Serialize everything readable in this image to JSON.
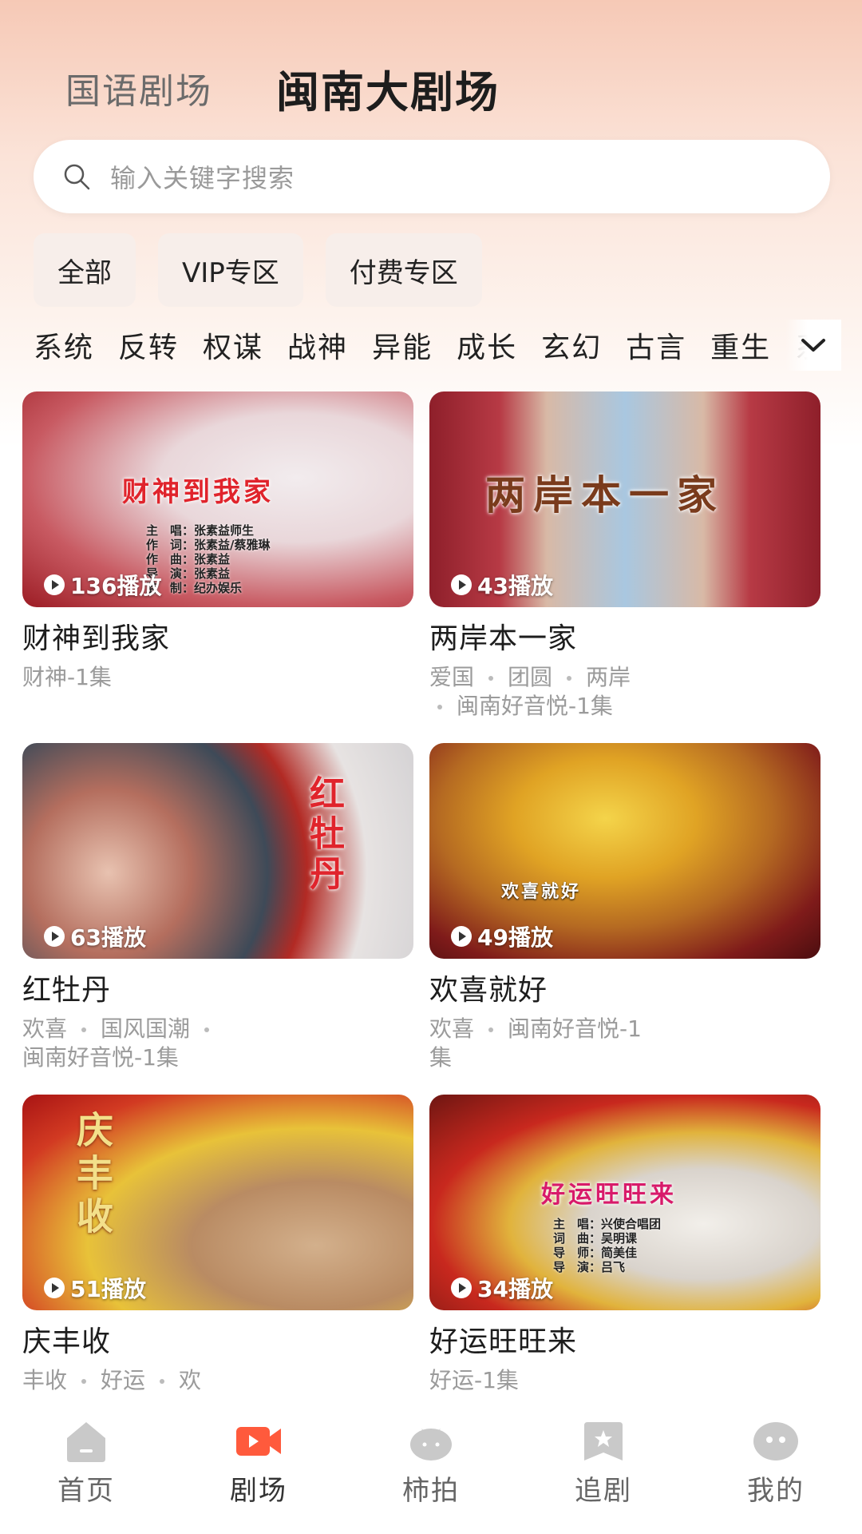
{
  "header": {
    "tabs": [
      {
        "label": "国语剧场",
        "active": false
      },
      {
        "label": "闽南大剧场",
        "active": true
      }
    ]
  },
  "search": {
    "placeholder": "输入关键字搜索",
    "icon": "search-icon"
  },
  "filters": [
    "全部",
    "VIP专区",
    "付费专区"
  ],
  "categories": [
    "系统",
    "反转",
    "权谋",
    "战神",
    "异能",
    "成长",
    "玄幻",
    "古言",
    "重生",
    "系"
  ],
  "cards": [
    {
      "thumb_text": "财神到我家",
      "credits": [
        "主　唱：张素益师生",
        "作　词：张素益/蔡雅琳",
        "作　曲：张素益",
        "导　演：张素益",
        "监　制：纪办娱乐"
      ],
      "plays": "136播放",
      "title": "财神到我家",
      "tags_line1": [
        "财神-1集"
      ],
      "tags_line2": []
    },
    {
      "thumb_text": "两岸本一家",
      "credits": [],
      "plays": "43播放",
      "title": "两岸本一家",
      "tags_line1": [
        "爱国",
        "团圆",
        "两岸"
      ],
      "tags_line2": [
        "闽南好音悦-1集"
      ]
    },
    {
      "thumb_text": "红牡丹",
      "credits": [],
      "plays": "63播放",
      "title": "红牡丹",
      "tags_line1": [
        "欢喜",
        "国风国潮"
      ],
      "tags_line2": [
        "闽南好音悦-1集"
      ]
    },
    {
      "thumb_text": "欢喜就好",
      "credits": [],
      "plays": "49播放",
      "title": "欢喜就好",
      "tags_line1": [
        "欢喜",
        "闽南好音悦-1"
      ],
      "tags_line2": [
        "集"
      ]
    },
    {
      "thumb_text": "庆丰收",
      "credits": [],
      "plays": "51播放",
      "title": "庆丰收",
      "tags_line1": [
        "丰收",
        "好运",
        "欢"
      ],
      "tags_line2": []
    },
    {
      "thumb_text": "好运旺旺来",
      "credits": [
        "主　唱：兴使合唱团",
        "词　曲：吴明课",
        "导　师：简美佳",
        "导　演：吕飞"
      ],
      "plays": "34播放",
      "title": "好运旺旺来",
      "tags_line1": [
        "好运-1集"
      ],
      "tags_line2": []
    }
  ],
  "tabbar": [
    {
      "label": "首页",
      "icon": "home-icon",
      "active": false
    },
    {
      "label": "剧场",
      "icon": "video-camera-icon",
      "active": true
    },
    {
      "label": "柿拍",
      "icon": "persimmon-icon",
      "active": false
    },
    {
      "label": "追剧",
      "icon": "bookmark-icon",
      "active": false
    },
    {
      "label": "我的",
      "icon": "profile-face-icon",
      "active": false
    }
  ],
  "colors": {
    "accent": "#ff5a3c",
    "title_red": "#e0242c",
    "icon_gray": "#c9c9c9"
  }
}
